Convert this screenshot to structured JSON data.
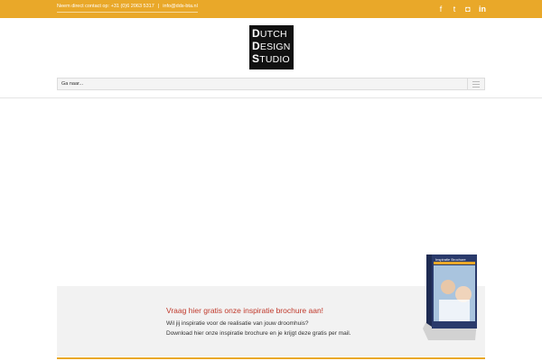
{
  "topbar": {
    "contact_text": "Neem direct contact op: +31 (0)6 2063 5317",
    "email": "info@dds-bta.nl",
    "social_icons": [
      "facebook-icon",
      "twitter-icon",
      "instagram-icon",
      "linkedin-icon"
    ],
    "social_glyphs": [
      "f",
      "t",
      "◘",
      "in"
    ],
    "color": "#e9a829"
  },
  "logo": {
    "line1_initial": "D",
    "line1_rest": "UTCH",
    "line2_initial": "D",
    "line2_rest": "ESIGN",
    "line3_initial": "S",
    "line3_rest": "TUDIO"
  },
  "nav": {
    "placeholder": "Ga naar..."
  },
  "promo": {
    "title": "Vraag hier gratis onze inspiratie brochure aan!",
    "line1": "Wil jij inspiratie voor de realisatie van jouw droomhuis?",
    "line2": "Download hier onze inspiratie brochure en je krijgt deze gratis per mail.",
    "brochure_label": "Inspiratie Brochure",
    "accent_color": "#c0392b"
  }
}
